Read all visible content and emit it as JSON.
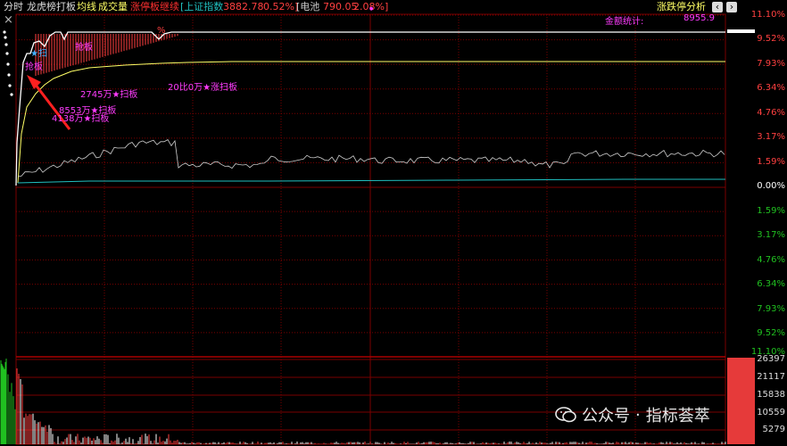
{
  "header": {
    "mode_label": "分时",
    "strategy_label": "龙虎榜打板",
    "avg_line_label": "均线",
    "volume_label": "成交量",
    "limit_up_label": "涨停板继续",
    "index_label": "[上证指数",
    "index_value": "3882.78",
    "index_change": "0.52%]",
    "stock_label": "[电池",
    "stock_value": "790.05",
    "stock_change": "2.08%]",
    "dot_label": "●",
    "analysis_label": "涨跌停分析",
    "prev_icon": "‹",
    "next_icon": "›"
  },
  "price_axis": {
    "upper": [
      "11.10%",
      "9.52%",
      "7.93%",
      "6.34%",
      "4.76%",
      "3.17%",
      "1.59%",
      "0.00%"
    ],
    "lower": [
      "1.59%",
      "3.17%",
      "4.76%",
      "6.34%",
      "7.93%",
      "9.52%",
      "11.10%"
    ]
  },
  "volume_axis": [
    "26397",
    "21117",
    "15838",
    "10559",
    "5279"
  ],
  "annotations": {
    "total_label": "金额统计:",
    "total_value": "8955.9",
    "star_top": "★扫",
    "star_top2": "抢板",
    "qiang_ban": "抢板",
    "saoban_2745": "2745万★扫板",
    "saoban_8553": "8553万★扫板",
    "saoban_4138": "4138万★扫板",
    "saoban_20": "20比0万★涨扫板",
    "pct_mark": "%"
  },
  "close_icon": "×",
  "watermark": {
    "brand": "公众号",
    "separator": "·",
    "name": "指标荟萃"
  },
  "colors": {
    "background": "#000000",
    "grid": "#7a0000",
    "price_line": "#ffffff",
    "avg_line": "#ffff66",
    "index_line": "#20c0c0",
    "up_color": "#ff4040",
    "down_color": "#20c020",
    "annotation": "#ff3cff",
    "arrow": "#ff2020"
  }
}
